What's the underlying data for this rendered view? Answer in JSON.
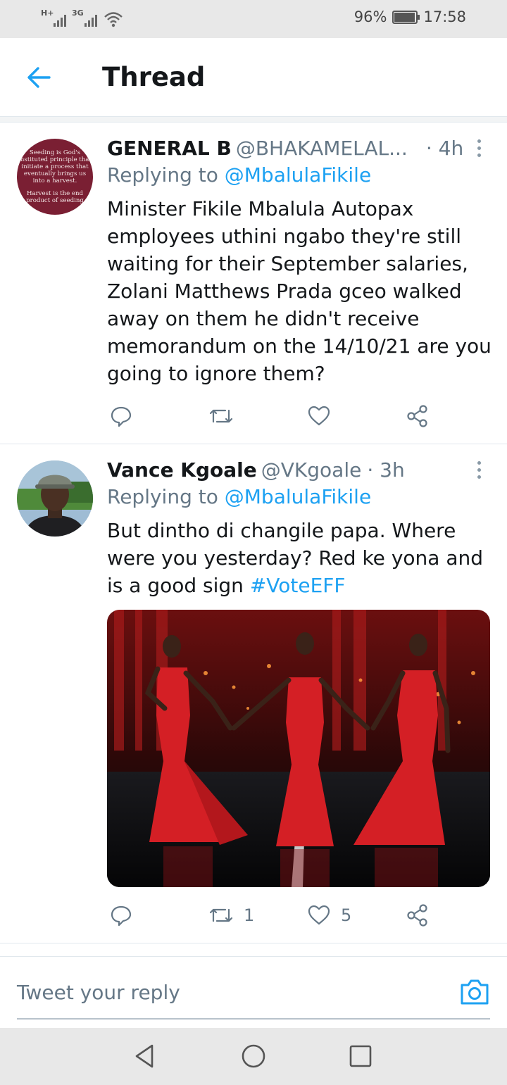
{
  "status_bar": {
    "network_1": "H+",
    "network_2": "3G",
    "battery_percent": "96%",
    "battery_level": 0.96,
    "time": "17:58"
  },
  "header": {
    "title": "Thread",
    "back_icon": "arrow-left-icon"
  },
  "colors": {
    "accent": "#1da1f2",
    "text": "#14171a",
    "muted": "#657786",
    "border": "#e1e8ed"
  },
  "tweets": [
    {
      "name": "GENERAL B",
      "handle": "@BHAKAMELAL...",
      "time": "· 4h",
      "replying_prefix": "Replying to",
      "replying_to": "@MbalulaFikile",
      "body": "Minister Fikile Mbalula Autopax employees uthini ngabo they're still waiting for their September salaries, Zolani Matthews Prada gceo walked away on them he didn't receive memorandum on the 14/10/21 are you going to ignore them?",
      "avatar_lines": [
        "Seeding is God's",
        "instituted principle that",
        "initiate a process that",
        "eventually brings us",
        "into a harvest.",
        "",
        "Harvest is the end",
        "product of seeding"
      ],
      "retweets": "",
      "likes": ""
    },
    {
      "name": "Vance Kgoale",
      "handle": "@VKgoale",
      "time": "· 3h",
      "replying_prefix": "Replying to",
      "replying_to": "@MbalulaFikile",
      "body_text": "But dintho di changile papa. Where were you yesterday? Red ke yona and is a good sign ",
      "hashtag": "#VoteEFF",
      "retweets": "1",
      "likes": "5"
    }
  ],
  "composer": {
    "placeholder": "Tweet your reply",
    "camera_icon": "camera-icon"
  },
  "nav": {
    "back": "nav-back-icon",
    "home": "nav-home-icon",
    "recents": "nav-recents-icon"
  }
}
